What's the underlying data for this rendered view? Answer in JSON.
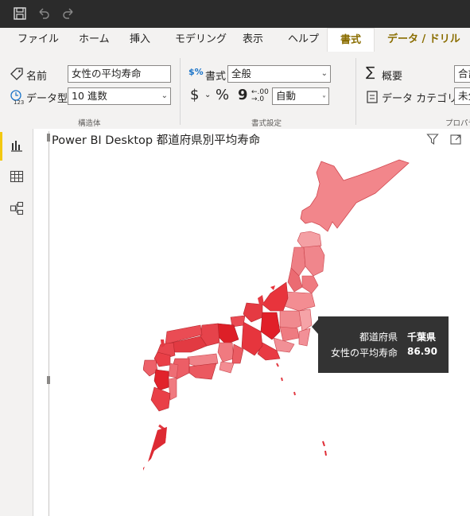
{
  "ribbon_tabs": {
    "file": "ファイル",
    "home": "ホーム",
    "insert": "挿入",
    "modeling": "モデリング",
    "view": "表示",
    "help": "ヘルプ",
    "format": "書式",
    "data_drill": "データ / ドリル"
  },
  "structure": {
    "name_label": "名前",
    "name_value": "女性の平均寿命",
    "datatype_label": "データ型",
    "datatype_value": "10 進数",
    "group_label": "構造体"
  },
  "formatting": {
    "format_label": "書式",
    "format_value": "全般",
    "dollar": "$",
    "percent": "%",
    "comma": "9",
    "decimal_icon_text": "←.00 .0",
    "auto_value": "自動",
    "group_label": "書式設定"
  },
  "properties": {
    "summary_label": "概要",
    "summary_value": "合計",
    "category_label": "データ カテゴリ",
    "category_value": "未分",
    "group_label": "プロパテ"
  },
  "visual": {
    "title": "Power BI Desktop 都道府県別平均寿命"
  },
  "tooltip": {
    "prefecture_label": "都道府県",
    "prefecture_value": "千葉県",
    "measure_label": "女性の平均寿命",
    "measure_value": "86.90"
  },
  "colors": {
    "accent_yellow": "#f2c811",
    "map_light": "#f08a8e",
    "map_dark": "#e8252f"
  }
}
